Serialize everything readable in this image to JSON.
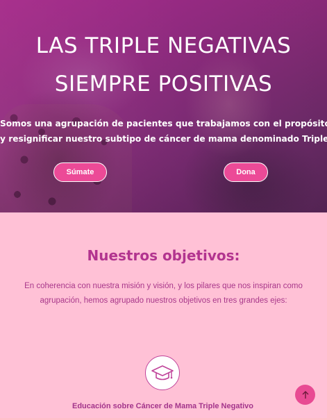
{
  "hero": {
    "title_line1": "LAS TRIPLE NEGATIVAS",
    "title_line2": "SIEMPRE POSITIVAS",
    "description_line1": "Somos una agrupación de pacientes que trabajamos con el propósito de visibilizar",
    "description_line2": "y resignificar nuestro subtipo de cáncer de mama denominado Triple Negativo.",
    "join_button": "Súmate",
    "donate_button": "Dona"
  },
  "objectives": {
    "title": "Nuestros objetivos:",
    "description_line1": "En coherencia con nuestra misión y visión, y los pilares que nos inspiran como",
    "description_line2": "agrupación, hemos agrupado nuestros objetivos en tres grandes ejes:",
    "items": [
      {
        "icon": "graduation-cap-icon",
        "label": "Educación sobre Cáncer de Mama Triple Negativo"
      }
    ]
  },
  "scroll_top": {
    "icon": "arrow-up-icon"
  },
  "colors": {
    "page_background": "#ffc1d6",
    "accent_pink": "#ec4a97",
    "heading_magenta": "#b2348f"
  }
}
